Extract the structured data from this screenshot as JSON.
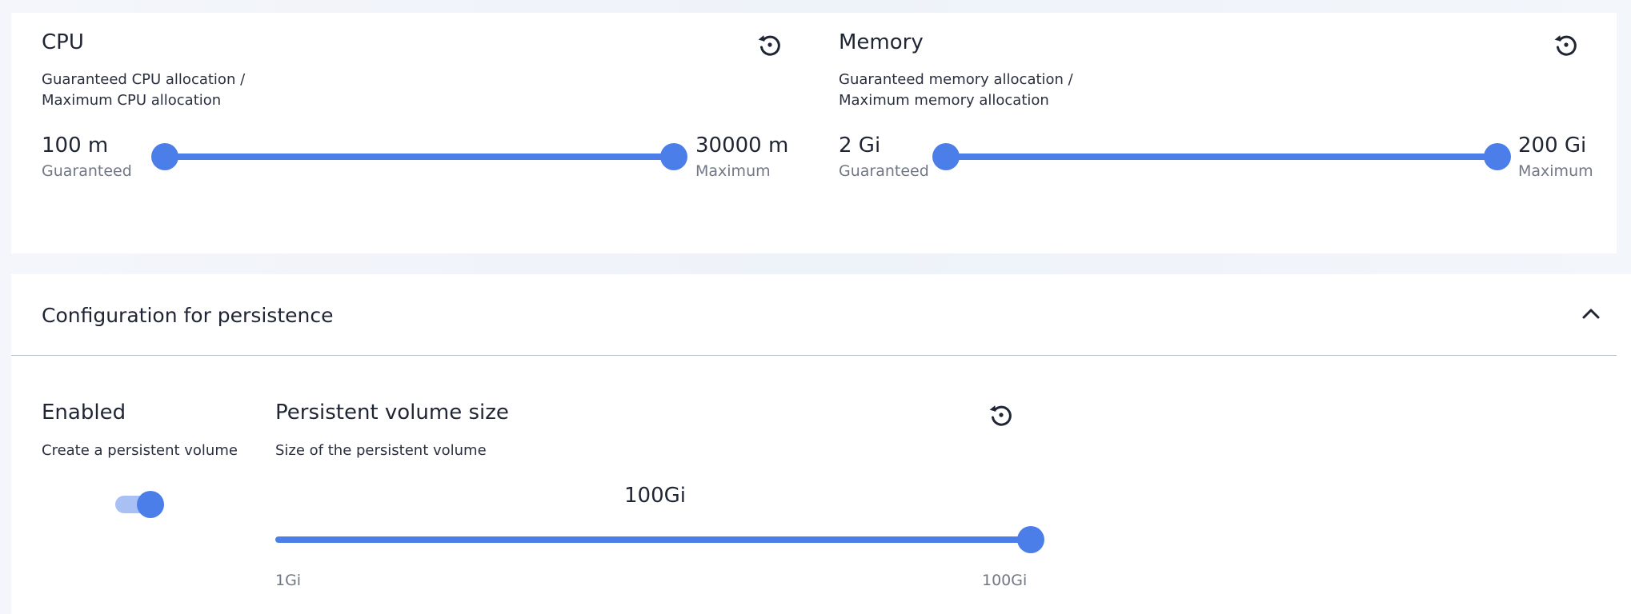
{
  "cpu": {
    "title": "CPU",
    "description": "Guaranteed CPU allocation / Maximum CPU allocation",
    "min_value": "100 m",
    "min_label": "Guaranteed",
    "max_value": "30000 m",
    "max_label": "Maximum",
    "reset_icon": "reset-icon"
  },
  "memory": {
    "title": "Memory",
    "description": "Guaranteed memory allocation / Maximum memory allocation",
    "min_value": "2 Gi",
    "min_label": "Guaranteed",
    "max_value": "200 Gi",
    "max_label": "Maximum",
    "reset_icon": "reset-icon"
  },
  "persistence": {
    "section_title": "Configuration for persistence",
    "collapse_icon": "chevron-up-icon",
    "enabled": {
      "title": "Enabled",
      "description": "Create a persistent volume",
      "value": true
    },
    "volume_size": {
      "title": "Persistent volume size",
      "description": "Size of the persistent volume",
      "current_value": "100Gi",
      "min_label": "1Gi",
      "max_label": "100Gi",
      "fraction": 1.0,
      "reset_icon": "reset-icon"
    }
  },
  "colors": {
    "accent": "#4c7ee9",
    "accent_light": "#a8c0f3",
    "text": "#1f2533",
    "muted": "#717784"
  }
}
